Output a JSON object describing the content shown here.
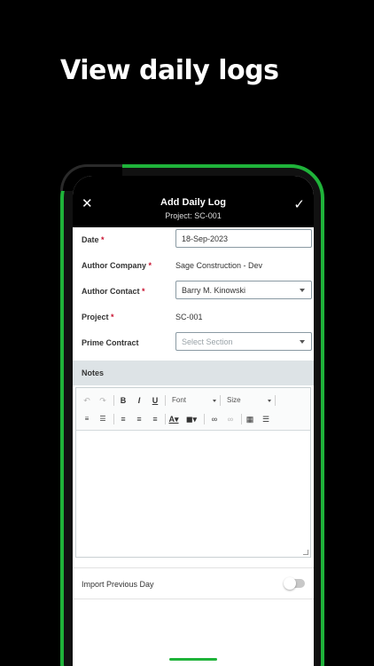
{
  "headline": "View daily logs",
  "colors": {
    "accent": "#1fb33a",
    "header_bg": "#000000",
    "required": "#c8102e",
    "notes_bar": "#dde3e6"
  },
  "header": {
    "title": "Add Daily Log",
    "subtitle": "Project: SC-001",
    "close_icon": "close-icon",
    "confirm_icon": "check-icon"
  },
  "form": {
    "date": {
      "label": "Date",
      "required_mark": "*",
      "value": "18-Sep-2023"
    },
    "author_company": {
      "label": "Author Company",
      "required_mark": "*",
      "value": "Sage Construction - Dev"
    },
    "author_contact": {
      "label": "Author Contact",
      "required_mark": "*",
      "value": "Barry M. Kinowski"
    },
    "project": {
      "label": "Project",
      "required_mark": "*",
      "value": "SC-001"
    },
    "prime_contract": {
      "label": "Prime Contract",
      "placeholder": "Select Section"
    }
  },
  "notes": {
    "label": "Notes",
    "toolbar": {
      "font_select": "Font",
      "size_select": "Size",
      "icons": [
        "undo-icon",
        "redo-icon",
        "bold-icon",
        "italic-icon",
        "underline-icon",
        "numbered-list-icon",
        "bulleted-list-icon",
        "align-left-icon",
        "align-center-icon",
        "align-right-icon",
        "text-color-icon",
        "background-color-icon",
        "link-icon",
        "unlink-icon",
        "table-icon",
        "horizontal-rule-icon"
      ]
    }
  },
  "import_previous_day": {
    "label": "Import Previous Day",
    "enabled": false
  }
}
